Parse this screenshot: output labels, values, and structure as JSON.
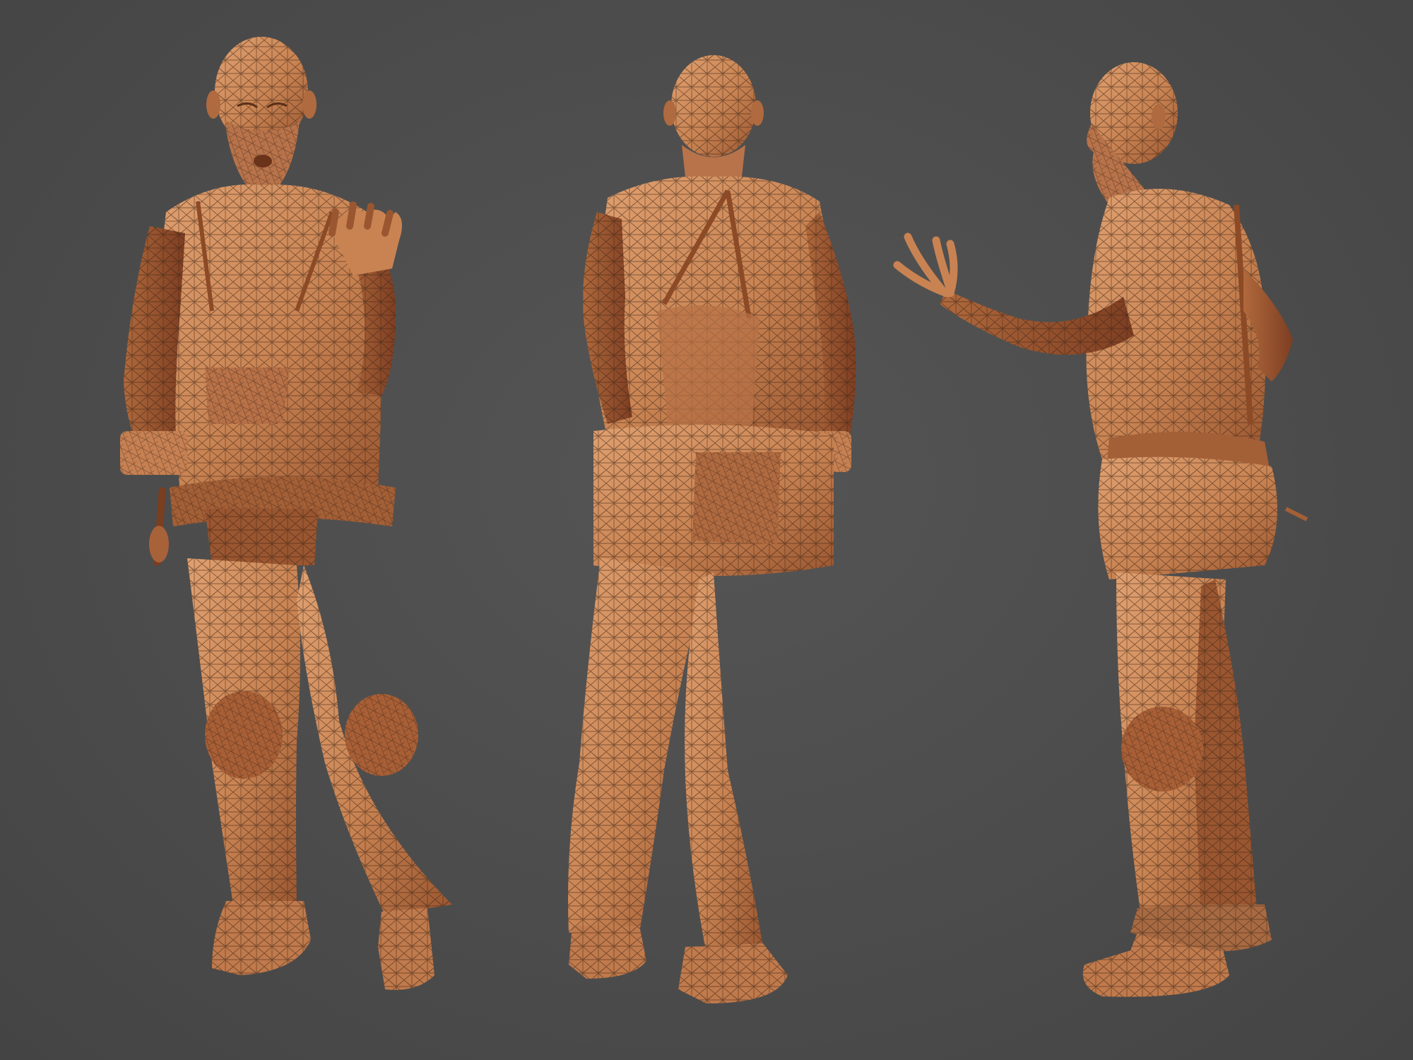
{
  "scene": {
    "background_color": "#4d4d4d",
    "mesh_color": "#cf8a5a",
    "mesh_shadow_color": "#8a4a2a",
    "wire_color": "#3a2416",
    "views": [
      {
        "name": "front-view",
        "description_icon": "figure-front"
      },
      {
        "name": "back-view",
        "description_icon": "figure-back"
      },
      {
        "name": "side-view",
        "description_icon": "figure-side"
      }
    ]
  }
}
